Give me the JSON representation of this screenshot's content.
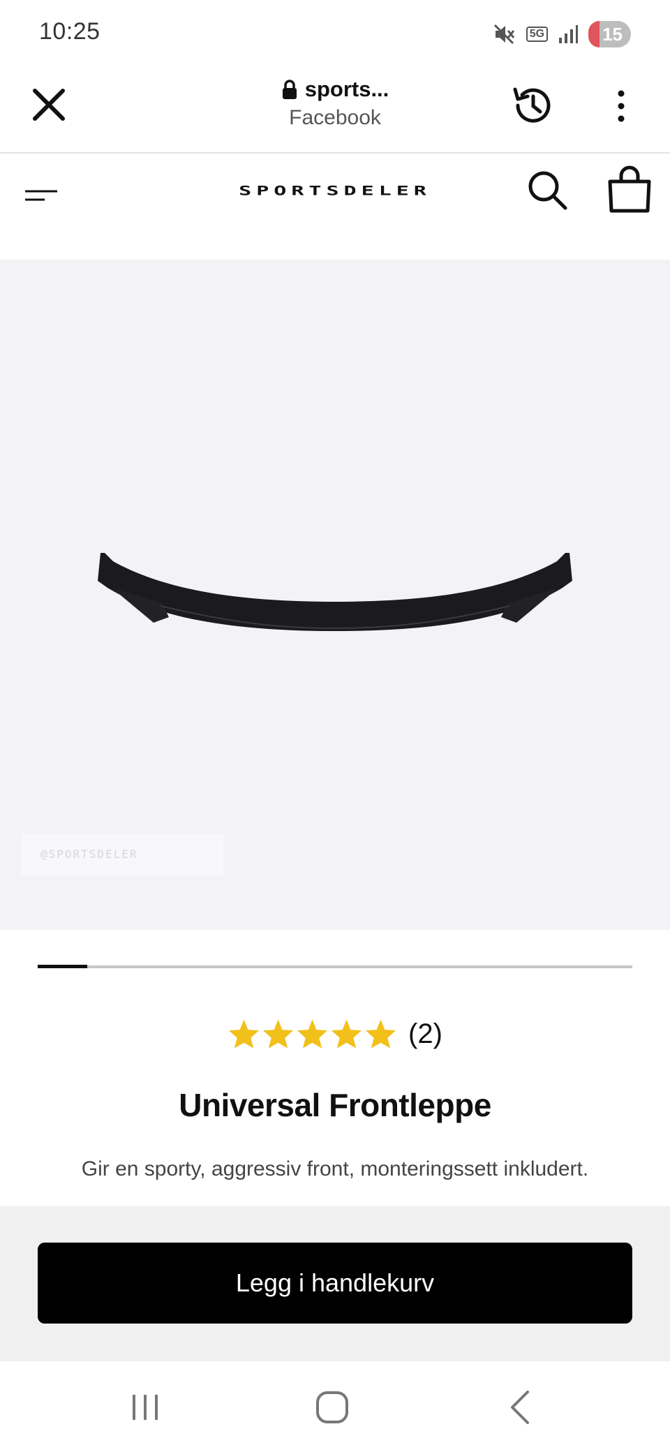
{
  "status": {
    "time": "10:25",
    "network": "5G",
    "battery": "15"
  },
  "browser": {
    "url": "sports...",
    "source": "Facebook"
  },
  "site": {
    "logo": "SPORTSDELER"
  },
  "product": {
    "watermark": "@SPORTSDELER",
    "gallery_progress": 0.083,
    "rating": 5,
    "review_count": "(2)",
    "title": "Universal Frontleppe",
    "description": "Gir en sporty, aggressiv front, monteringssett inkludert.",
    "add_to_cart_label": "Legg i handlekurv",
    "star_color": "#f2c01a"
  },
  "icons": {
    "status": [
      "mute-icon",
      "network-5g-icon",
      "signal-icon",
      "battery-icon"
    ],
    "browser": [
      "close-icon",
      "lock-icon",
      "history-icon",
      "more-vertical-icon"
    ],
    "site": [
      "menu-icon",
      "search-icon",
      "shopping-bag-icon"
    ],
    "navigation": [
      "recent-apps-icon",
      "home-icon",
      "back-icon"
    ]
  }
}
